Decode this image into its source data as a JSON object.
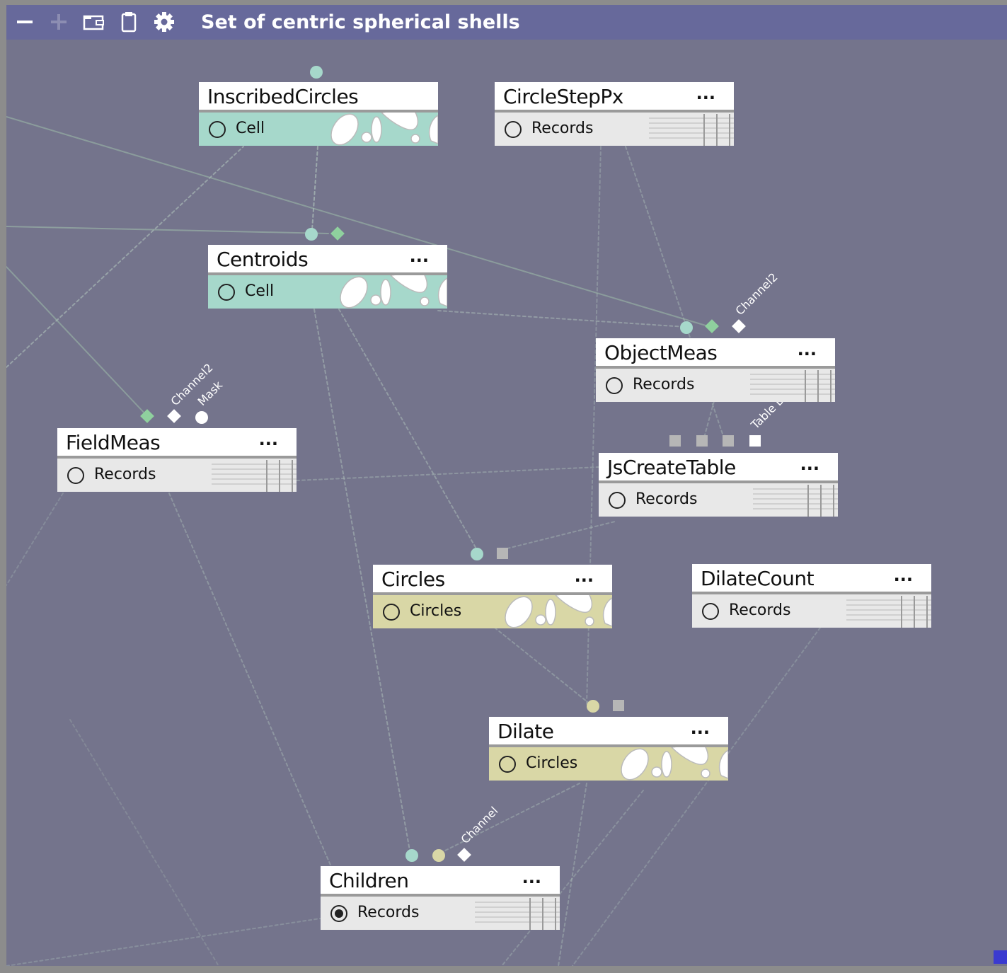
{
  "window": {
    "title": "Set of centric spherical shells"
  },
  "toolbar": {
    "icons": [
      "minus-icon",
      "plus-icon",
      "import-icon",
      "clipboard-icon",
      "gear-icon"
    ]
  },
  "nodes": [
    {
      "id": "inscribed",
      "name": "InscribedCircles",
      "menu": "",
      "type": "Cell",
      "kind": "cell"
    },
    {
      "id": "circlestep",
      "name": "CircleStepPx",
      "menu": "...",
      "type": "Records",
      "kind": "records"
    },
    {
      "id": "centroids",
      "name": "Centroids",
      "menu": "...",
      "type": "Cell",
      "kind": "cell"
    },
    {
      "id": "objectmeas",
      "name": "ObjectMeas",
      "menu": "...",
      "type": "Records",
      "kind": "records"
    },
    {
      "id": "fieldmeas",
      "name": "FieldMeas",
      "menu": "...",
      "type": "Records",
      "kind": "records"
    },
    {
      "id": "jscreatetable",
      "name": "JsCreateTable",
      "menu": "...",
      "type": "Records",
      "kind": "records"
    },
    {
      "id": "circles",
      "name": "Circles",
      "menu": "...",
      "type": "Circles",
      "kind": "circles"
    },
    {
      "id": "dilatecount",
      "name": "DilateCount",
      "menu": "...",
      "type": "Records",
      "kind": "records"
    },
    {
      "id": "dilate",
      "name": "Dilate",
      "menu": "...",
      "type": "Circles",
      "kind": "circles"
    },
    {
      "id": "children",
      "name": "Children",
      "menu": "...",
      "type": "Records",
      "kind": "records",
      "selected": true
    }
  ],
  "pin_labels": {
    "objectmeas_channel2": "Channel2",
    "fieldmeas_channel2": "Channel2",
    "fieldmeas_mask": "Mask",
    "jscreatetable_table": "Table D",
    "children_channel": "Channel"
  },
  "colors": {
    "canvas": "#74748c",
    "titlebar": "#67699b",
    "cell": "#a6d8cb",
    "circles": "#d9d7a6",
    "records": "#e8e8e8",
    "edge": "#9cb3a8"
  }
}
